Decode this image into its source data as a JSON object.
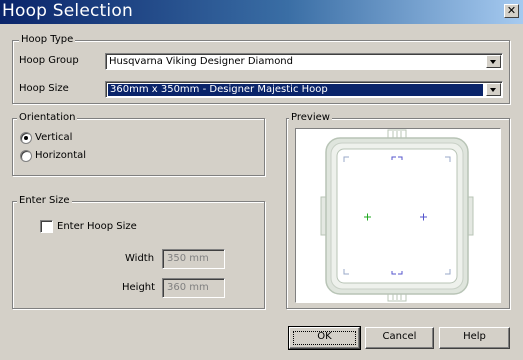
{
  "window": {
    "title": "Hoop Selection",
    "close_glyph": "✕"
  },
  "hoop_type": {
    "legend": "Hoop Type",
    "group_label": "Hoop Group",
    "group_value": "Husqvarna Viking Designer Diamond",
    "size_label": "Hoop Size",
    "size_value": "360mm x 350mm - Designer Majestic Hoop"
  },
  "orientation": {
    "legend": "Orientation",
    "options": [
      {
        "label": "Vertical",
        "checked": true
      },
      {
        "label": "Horizontal",
        "checked": false
      }
    ]
  },
  "preview": {
    "legend": "Preview"
  },
  "enter_size": {
    "legend": "Enter Size",
    "checkbox_label": "Enter Hoop Size",
    "checkbox_checked": false,
    "width_label": "Width",
    "width_value": "350 mm",
    "height_label": "Height",
    "height_value": "360 mm"
  },
  "buttons": {
    "ok": "OK",
    "cancel": "Cancel",
    "help": "Help"
  },
  "colors": {
    "title_gradient_start": "#0a246a",
    "title_gradient_end": "#a6caf0",
    "selection": "#0a246a",
    "hoop_frame": "#b8c4b6",
    "marker_green": "#22aa22",
    "marker_blue": "#5555cc"
  }
}
